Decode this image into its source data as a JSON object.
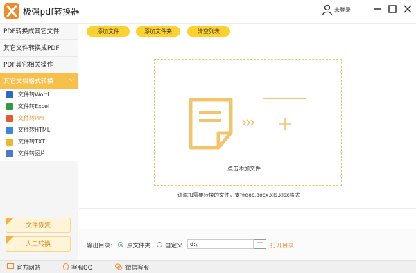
{
  "app": {
    "title": "极强pdf转换器",
    "login": "未登录"
  },
  "sidebar": {
    "categories": [
      {
        "label": "PDF转换成其它文件"
      },
      {
        "label": "其它文件转换成PDF"
      },
      {
        "label": "PDF其它相关操作"
      },
      {
        "label": "其它文档格式转换",
        "expanded": true
      }
    ],
    "sub_items": [
      {
        "label": "文件转Word",
        "icon": "word-icon"
      },
      {
        "label": "文件转Excel",
        "icon": "excel-icon"
      },
      {
        "label": "文件转PPT",
        "icon": "ppt-icon",
        "active": true
      },
      {
        "label": "文件转HTML",
        "icon": "html-icon"
      },
      {
        "label": "文件转TXT",
        "icon": "txt-icon"
      },
      {
        "label": "文件转图片",
        "icon": "image-icon"
      }
    ],
    "recover_label": "文件恢复",
    "manual_label": "人工转换"
  },
  "toolbar": {
    "add_file": "添加文件",
    "add_folder": "添加文件夹",
    "clear_list": "清空列表"
  },
  "dropzone": {
    "hint": "点击添加文件",
    "formats": "请添加需要转换的文件，支持doc,docx,xls,xlsx格式"
  },
  "output": {
    "label": "输出目录:",
    "option_original": "原文件夹",
    "option_custom": "自定义",
    "path": "d:\\",
    "browse": "···",
    "open_dir": "打开目录",
    "selected": "原文件夹"
  },
  "footer": {
    "website": "官方网站",
    "qq": "客服QQ",
    "wechat": "微信客服"
  },
  "colors": {
    "accent": "#f6c04a",
    "button": "#ffd12e",
    "orange": "#f08a24"
  }
}
